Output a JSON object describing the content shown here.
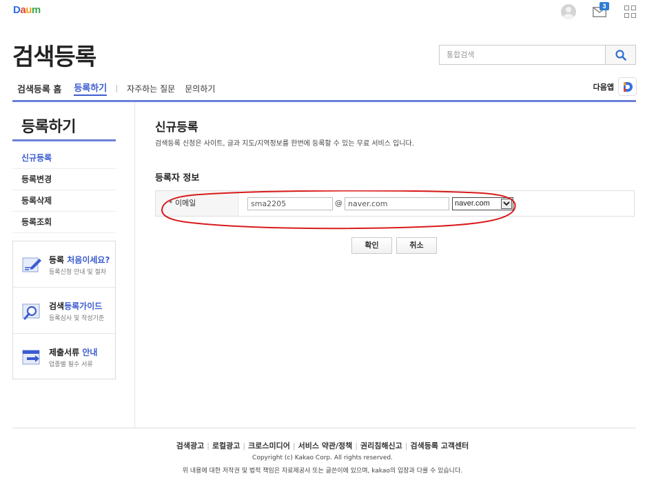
{
  "brand": {
    "logo_text": "Daum",
    "colors": {
      "accent": "#3b5bd1",
      "rule": "#6c7fd9",
      "annotation": "#d91a1a"
    }
  },
  "top_bar": {
    "icons": [
      "user-avatar-icon",
      "mail-icon",
      "app-grid-icon"
    ],
    "mail_count": "3"
  },
  "header": {
    "title": "검색등록",
    "search": {
      "placeholder": "통합검색"
    }
  },
  "gnb": {
    "items": [
      "검색등록 홈",
      "등록하기",
      "자주하는 질문",
      "문의하기"
    ],
    "active_index": 1,
    "app_label": "다음앱"
  },
  "sidebar": {
    "title": "등록하기",
    "menu": [
      "신규등록",
      "등록변경",
      "등록삭제",
      "등록조회"
    ],
    "active_index": 0,
    "guides": [
      {
        "title_plain": "등록 ",
        "title_highlight": "처음이세요?",
        "subtitle": "등록신청 안내 및 절차",
        "icon": "pencil-doc-icon"
      },
      {
        "title_plain": "검색",
        "title_highlight": "등록가이드",
        "subtitle": "등록심사 및 작성기준",
        "icon": "magnifier-doc-icon"
      },
      {
        "title_plain": "제출서류 ",
        "title_highlight": "안내",
        "subtitle": "업종별 필수 서류",
        "icon": "document-arrow-icon"
      }
    ]
  },
  "content": {
    "title": "신규등록",
    "description": "검색등록 신청은 사이트, 글과 지도/지역정보를 한번에 등록할 수 있는 무료 서비스 입니다.",
    "section_title": "등록자 정보",
    "form": {
      "email_label": "* 이메일",
      "email_local": "sma2205",
      "at_sign": "@",
      "email_domain": "naver.com",
      "domain_select": "naver.com"
    },
    "buttons": {
      "ok": "확인",
      "cancel": "취소"
    }
  },
  "footer": {
    "links": [
      "검색광고",
      "로컬광고",
      "크로스미디어",
      "서비스 약관/정책",
      "권리침해신고",
      "검색등록 고객센터"
    ],
    "copyright": "Copyright (c) Kakao Corp. All rights reserved.",
    "disclaimer": "위 내용에 대한 저작권 및 법적 책임은 자료제공사 또는 글쓴이에 있으며, kakao의 입장과 다를 수 있습니다."
  }
}
